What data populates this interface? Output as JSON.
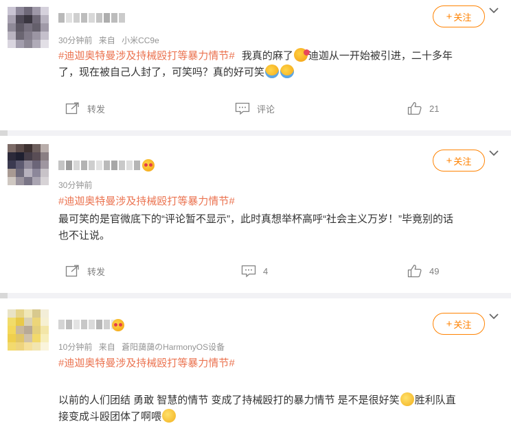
{
  "comments": [
    {
      "username_label": "",
      "time": "30分钟前",
      "source_prefix": "来自",
      "source": "小米CC9e",
      "topic": "#迪迦奥特曼涉及持械殴打等暴力情节#",
      "text_parts": [
        "我真的麻了",
        "迪迦从一开始被引进，二十多年",
        "了，现在被自己人封了，可笑吗？真的好可笑"
      ],
      "follow_label": "关注",
      "repost_label": "转发",
      "comment_label": "评论",
      "like_count": "21"
    },
    {
      "time": "30分钟前",
      "topic": "#迪迦奥特曼涉及持械殴打等暴力情节#",
      "text_lines": [
        "最可笑的是官微底下的“评论暂不显示”，此时真想举杯高呼“社会主义万岁！”毕竟别的话",
        "也不让说。"
      ],
      "follow_label": "关注",
      "repost_label": "转发",
      "comment_count": "4",
      "like_count": "49"
    },
    {
      "time": "10分钟前",
      "source_prefix": "来自",
      "source": "蒼阳藹藹のHarmonyOS设备",
      "topic": "#迪迦奥特曼涉及持械殴打等暴力情节#",
      "text_parts": [
        "以前的人们团结 勇敢 智慧的情节 变成了持械殴打的暴力情节 是不是很好笑",
        "胜利队直",
        "接变成斗殴团体了啊喂"
      ],
      "follow_label": "关注"
    }
  ],
  "icons": {
    "follow_plus": "plus-icon",
    "menu": "chevron-down-icon",
    "repost": "share-icon",
    "comment": "comment-icon",
    "like": "thumbs-up-icon"
  },
  "colors": {
    "accent_orange": "#ff8200",
    "topic_orange": "#eb7350",
    "meta_gray": "#939393",
    "text": "#333333"
  }
}
